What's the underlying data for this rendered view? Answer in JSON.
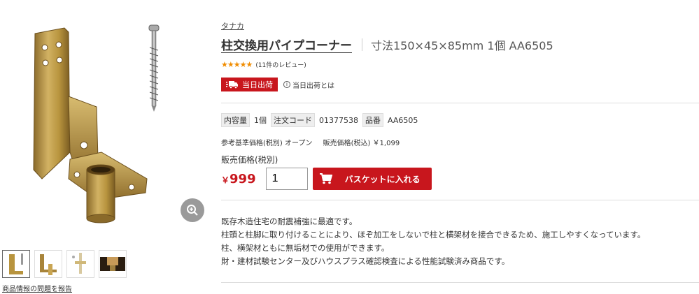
{
  "product": {
    "brand": "タナカ",
    "title": "柱交換用パイプコーナー",
    "spec": "寸法150×45×85mm 1個 AA6505",
    "stars": "★★★★★",
    "review_count": "(11件のレビュー)",
    "rating": 5
  },
  "shipping": {
    "badge": "当日出荷",
    "info_link": "当日出荷とは",
    "info_icon": "i"
  },
  "meta": {
    "capacity_label": "内容量",
    "capacity_value": "1個",
    "order_code_label": "注文コード",
    "order_code_value": "01377538",
    "part_label": "品番",
    "part_value": "AA6505"
  },
  "pricing": {
    "reference": "参考基準価格(税別) オープン",
    "sale_incl": "販売価格(税込) ￥1,099",
    "sale_label": "販売価格(税別)",
    "currency": "￥",
    "price": "999"
  },
  "cart": {
    "quantity": "1",
    "button_label": "バスケットに入れる"
  },
  "description": [
    "既存木造住宅の耐震補強に最適です。",
    "柱頭と柱脚に取り付けることにより、ほぞ加工をしないで柱と横架材を接合できるため、施工しやすくなっています。",
    "柱、横架材ともに無垢材での使用ができます。",
    "財・建材試験センター及びハウスプラス確認検査による性能試験済み商品です。"
  ],
  "gallery": {
    "report_link": "商品情報の問題を報告"
  },
  "colors": {
    "accent": "#c8161d",
    "star": "#f08c00",
    "bracket": "#b8943e"
  }
}
